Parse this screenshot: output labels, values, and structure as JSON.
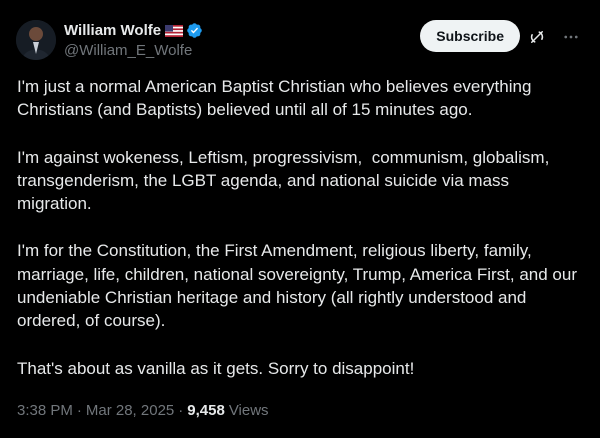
{
  "author": {
    "name": "William Wolfe",
    "handle": "@William_E_Wolfe",
    "flag_icon": "us-flag-icon",
    "verified_icon": "verified-badge-icon",
    "verified_color": "#1d9bf0"
  },
  "actions": {
    "subscribe_label": "Subscribe",
    "grok_icon": "grok-icon",
    "more_icon": "more-icon"
  },
  "post": {
    "paragraphs": [
      "I'm just a normal American Baptist Christian who believes everything Christians (and Baptists) believed until all of 15 minutes ago.",
      "I'm against wokeness, Leftism, progressivism,  communism, globalism, transgenderism, the LGBT agenda, and national suicide via mass migration.",
      "I'm for the Constitution, the First Amendment, religious liberty, family, marriage, life, children, national sovereignty, Trump, America First, and our undeniable Christian heritage and history (all rightly understood and ordered, of course).",
      "That's about as vanilla as it gets. Sorry to disappoint!"
    ]
  },
  "meta": {
    "time": "3:38 PM",
    "date": "Mar 28, 2025",
    "separator": "·",
    "views_count": "9,458",
    "views_label": "Views"
  },
  "colors": {
    "background": "#000000",
    "text": "#e7e9ea",
    "secondary": "#71767b",
    "button_bg": "#eff3f4"
  }
}
